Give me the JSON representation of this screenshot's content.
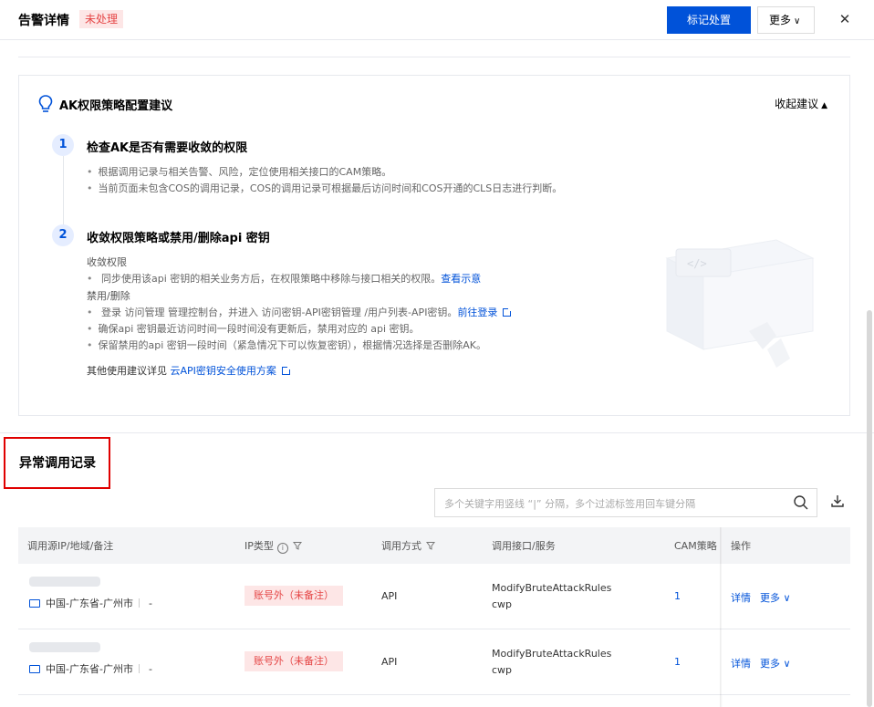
{
  "header": {
    "title": "告警详情",
    "status": "未处理",
    "primary_button": "标记处置",
    "more_button": "更多"
  },
  "suggestion": {
    "title": "AK权限策略配置建议",
    "collapse_label": "收起建议",
    "steps": [
      {
        "number": "1",
        "title": "检查AK是否有需要收敛的权限",
        "bullets": [
          "根据调用记录与相关告警、风险，定位使用相关接口的CAM策略。",
          "当前页面未包含COS的调用记录，COS的调用记录可根据最后访问时间和COS开通的CLS日志进行判断。"
        ]
      },
      {
        "number": "2",
        "title": "收敛权限策略或禁用/删除api 密钥",
        "sub1_title": "收敛权限",
        "sub1_bullet": "同步使用该api 密钥的相关业务方后，在权限策略中移除与接口相关的权限。",
        "sub1_link": "查看示意",
        "sub2_title": "禁用/删除",
        "sub2_bullets": [
          "登录 访问管理 管理控制台，并进入 访问密钥-API密钥管理 /用户列表-API密钥。",
          "确保api 密钥最近访问时间一段时间没有更新后，禁用对应的 api 密钥。",
          "保留禁用的api 密钥一段时间（紧急情况下可以恢复密钥），根据情况选择是否删除AK。"
        ],
        "sub2_link": "前往登录"
      }
    ],
    "footer_text": "其他使用建议详见",
    "footer_link": "云API密钥安全使用方案"
  },
  "records": {
    "title": "异常调用记录",
    "search_placeholder": "多个关键字用竖线 “|” 分隔，多个过滤标签用回车键分隔",
    "columns": [
      "调用源IP/地域/备注",
      "IP类型",
      "调用方式",
      "调用接口/服务",
      "CAM策略",
      "操作"
    ],
    "rows": [
      {
        "region": "中国-广东省-广州市",
        "note": "-",
        "ip_type": "账号外（未备注）",
        "method": "API",
        "api": "ModifyBruteAttackRules",
        "service": "cwp",
        "cam": "1",
        "op_detail": "详情",
        "op_more": "更多"
      },
      {
        "region": "中国-广东省-广州市",
        "note": "-",
        "ip_type": "账号外（未备注）",
        "method": "API",
        "api": "ModifyBruteAttackRules",
        "service": "cwp",
        "cam": "1",
        "op_detail": "详情",
        "op_more": "更多"
      }
    ]
  },
  "colors": {
    "primary": "#0052d9",
    "danger": "#e54545",
    "danger_bg": "#fde6e6",
    "highlight_box": "#e00000"
  }
}
